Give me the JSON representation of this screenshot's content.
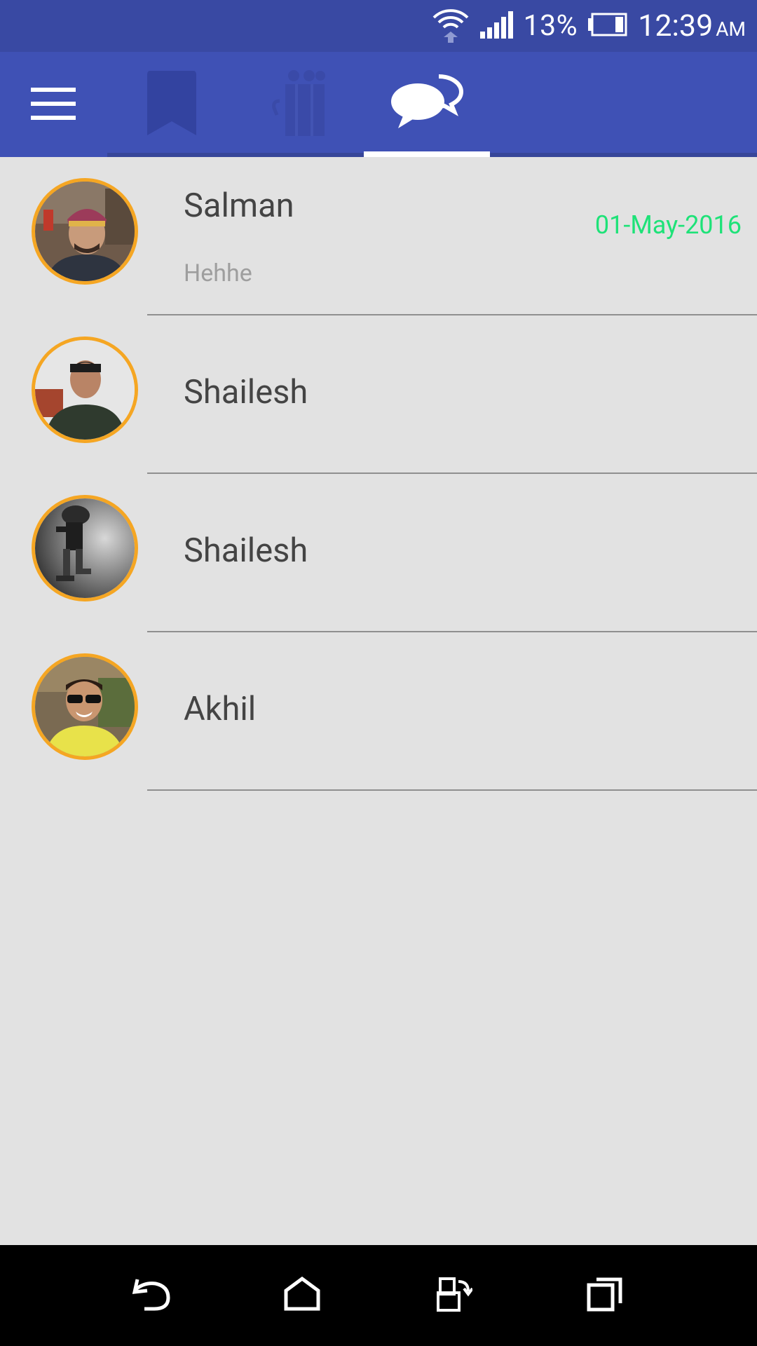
{
  "status_bar": {
    "battery_percent": "13%",
    "time": "12:39",
    "ampm": "AM",
    "icons": [
      "wifi-icon",
      "signal-icon",
      "battery-icon"
    ]
  },
  "app_bar": {
    "menu_icon": "hamburger-menu-icon",
    "tabs": [
      {
        "icon": "bookmark-icon",
        "selected": false
      },
      {
        "icon": "people-icon",
        "selected": false
      },
      {
        "icon": "chat-bubbles-icon",
        "selected": true
      }
    ],
    "colors": {
      "primary": "#3f51b5",
      "primary_dark": "#3949a3",
      "accent": "#f5a623"
    }
  },
  "chats": [
    {
      "name": "Salman",
      "preview": "Hehhe",
      "date": "01-May-2016"
    },
    {
      "name": "Shailesh"
    },
    {
      "name": "Shailesh"
    },
    {
      "name": "Akhil"
    }
  ],
  "nav_bar": {
    "buttons": [
      "back-icon",
      "home-icon",
      "screen-rotate-icon",
      "recent-apps-icon"
    ]
  }
}
